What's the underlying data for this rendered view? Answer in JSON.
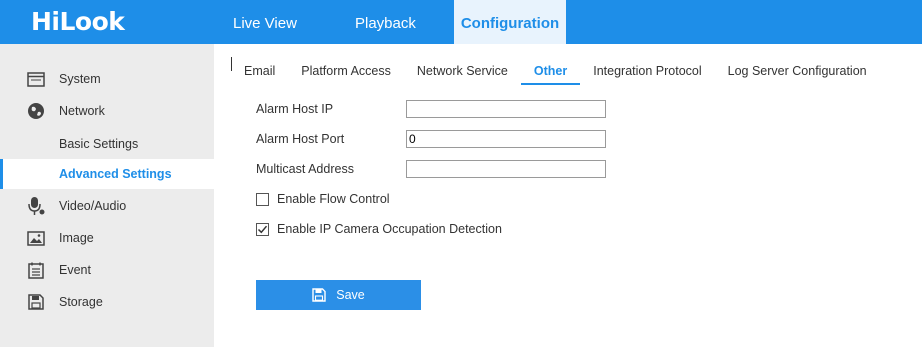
{
  "header": {
    "logo": "HiLook",
    "nav": [
      {
        "label": "Live View",
        "active": false
      },
      {
        "label": "Playback",
        "active": false
      },
      {
        "label": "Configuration",
        "active": true
      }
    ],
    "accent_color": "#1e8ee8"
  },
  "sidebar": {
    "items": [
      {
        "label": "System",
        "icon": "monitor-icon"
      },
      {
        "label": "Network",
        "icon": "globe-icon"
      },
      {
        "label": "Basic Settings"
      },
      {
        "label": "Advanced Settings",
        "active": true
      },
      {
        "label": "Video/Audio",
        "icon": "microphone-icon"
      },
      {
        "label": "Image",
        "icon": "image-icon"
      },
      {
        "label": "Event",
        "icon": "event-list-icon"
      },
      {
        "label": "Storage",
        "icon": "floppy-disk-icon"
      }
    ]
  },
  "tabs": [
    {
      "label": "Email"
    },
    {
      "label": "Platform Access"
    },
    {
      "label": "Network Service"
    },
    {
      "label": "Other",
      "active": true
    },
    {
      "label": "Integration Protocol"
    },
    {
      "label": "Log Server Configuration"
    }
  ],
  "form": {
    "alarm_host_ip": {
      "label": "Alarm Host IP",
      "value": ""
    },
    "alarm_host_port": {
      "label": "Alarm Host Port",
      "value": "0"
    },
    "multicast_address": {
      "label": "Multicast Address",
      "value": ""
    },
    "enable_flow_control": {
      "label": "Enable Flow Control",
      "checked": false
    },
    "enable_ip_camera_occupation": {
      "label": "Enable IP Camera Occupation Detection",
      "checked": true
    }
  },
  "save_button": {
    "label": "Save",
    "icon": "floppy-disk-icon"
  }
}
